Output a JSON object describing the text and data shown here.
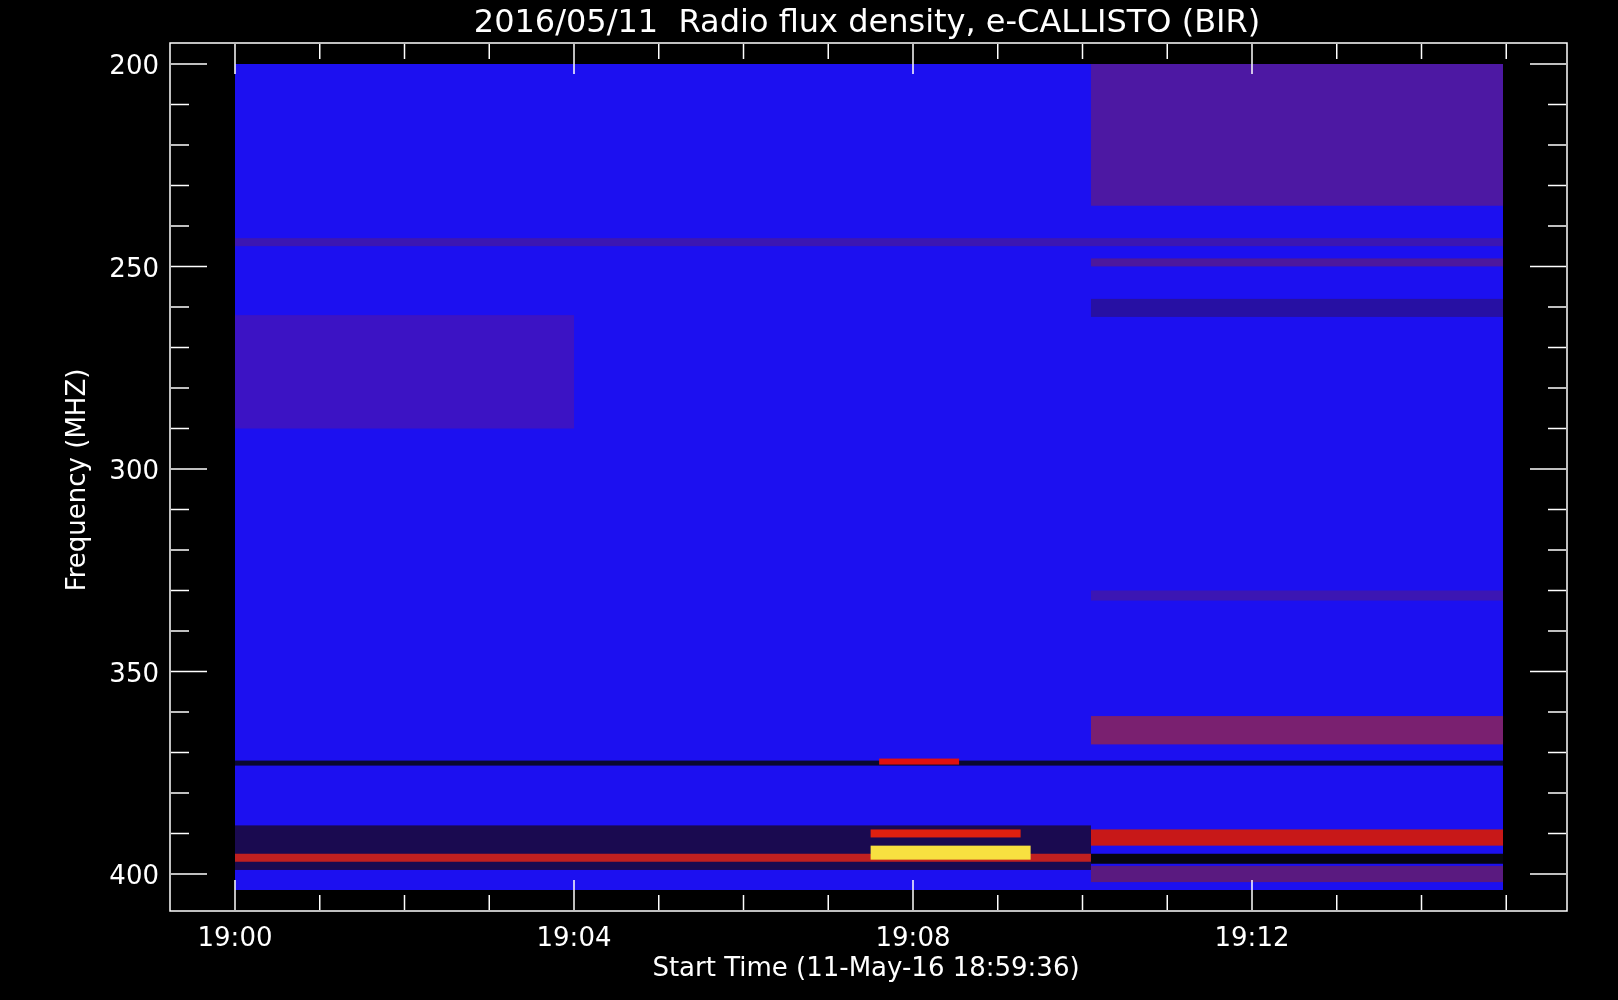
{
  "title": "2016/05/11  Radio flux density, e-CALLISTO (BIR)",
  "y_axis": {
    "label": "Frequency (MHZ)",
    "ticks": [
      "200",
      "250",
      "300",
      "350",
      "400"
    ]
  },
  "x_axis": {
    "label": "Start Time (11-May-16 18:59:36)",
    "ticks": [
      "19:00",
      "19:04",
      "19:08",
      "19:12"
    ]
  }
}
